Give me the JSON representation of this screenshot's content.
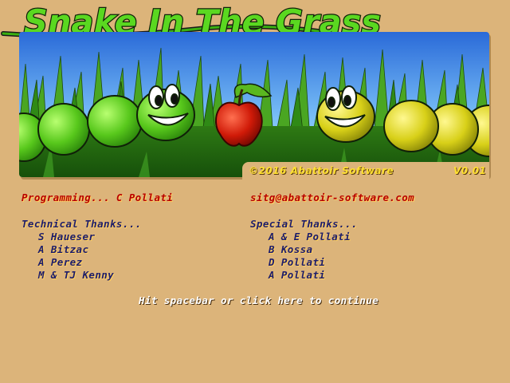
{
  "title": "Snake In The Grass",
  "banner": {
    "copyright": "©2016 Abattoir Software",
    "version": "V0.01"
  },
  "credits": {
    "programming_label": "Programming... C Pollati",
    "email": "sitg@abattoir-software.com",
    "technical_title": "Technical Thanks...",
    "technical_names": [
      "S Haueser",
      "A Bitzac",
      "A Perez",
      "M & TJ Kenny"
    ],
    "special_title": "Special Thanks...",
    "special_names": [
      "A & E Pollati",
      "B Kossa",
      "D Pollati",
      "A Pollati"
    ]
  },
  "continue_text": "Hit spacebar or click here to continue",
  "colors": {
    "background": "#dcb47a",
    "sky": "#5aa4f0",
    "grass": "#3a8a1a",
    "snake_green": "#5acc20",
    "snake_yellow": "#d8d018",
    "apple": "#cc1a08",
    "footer_text": "#ffe030",
    "credit_red": "#b80000",
    "credit_navy": "#1c1c6c"
  },
  "icons": [
    "green-snake-icon",
    "yellow-snake-icon",
    "apple-icon",
    "grass-icon"
  ]
}
